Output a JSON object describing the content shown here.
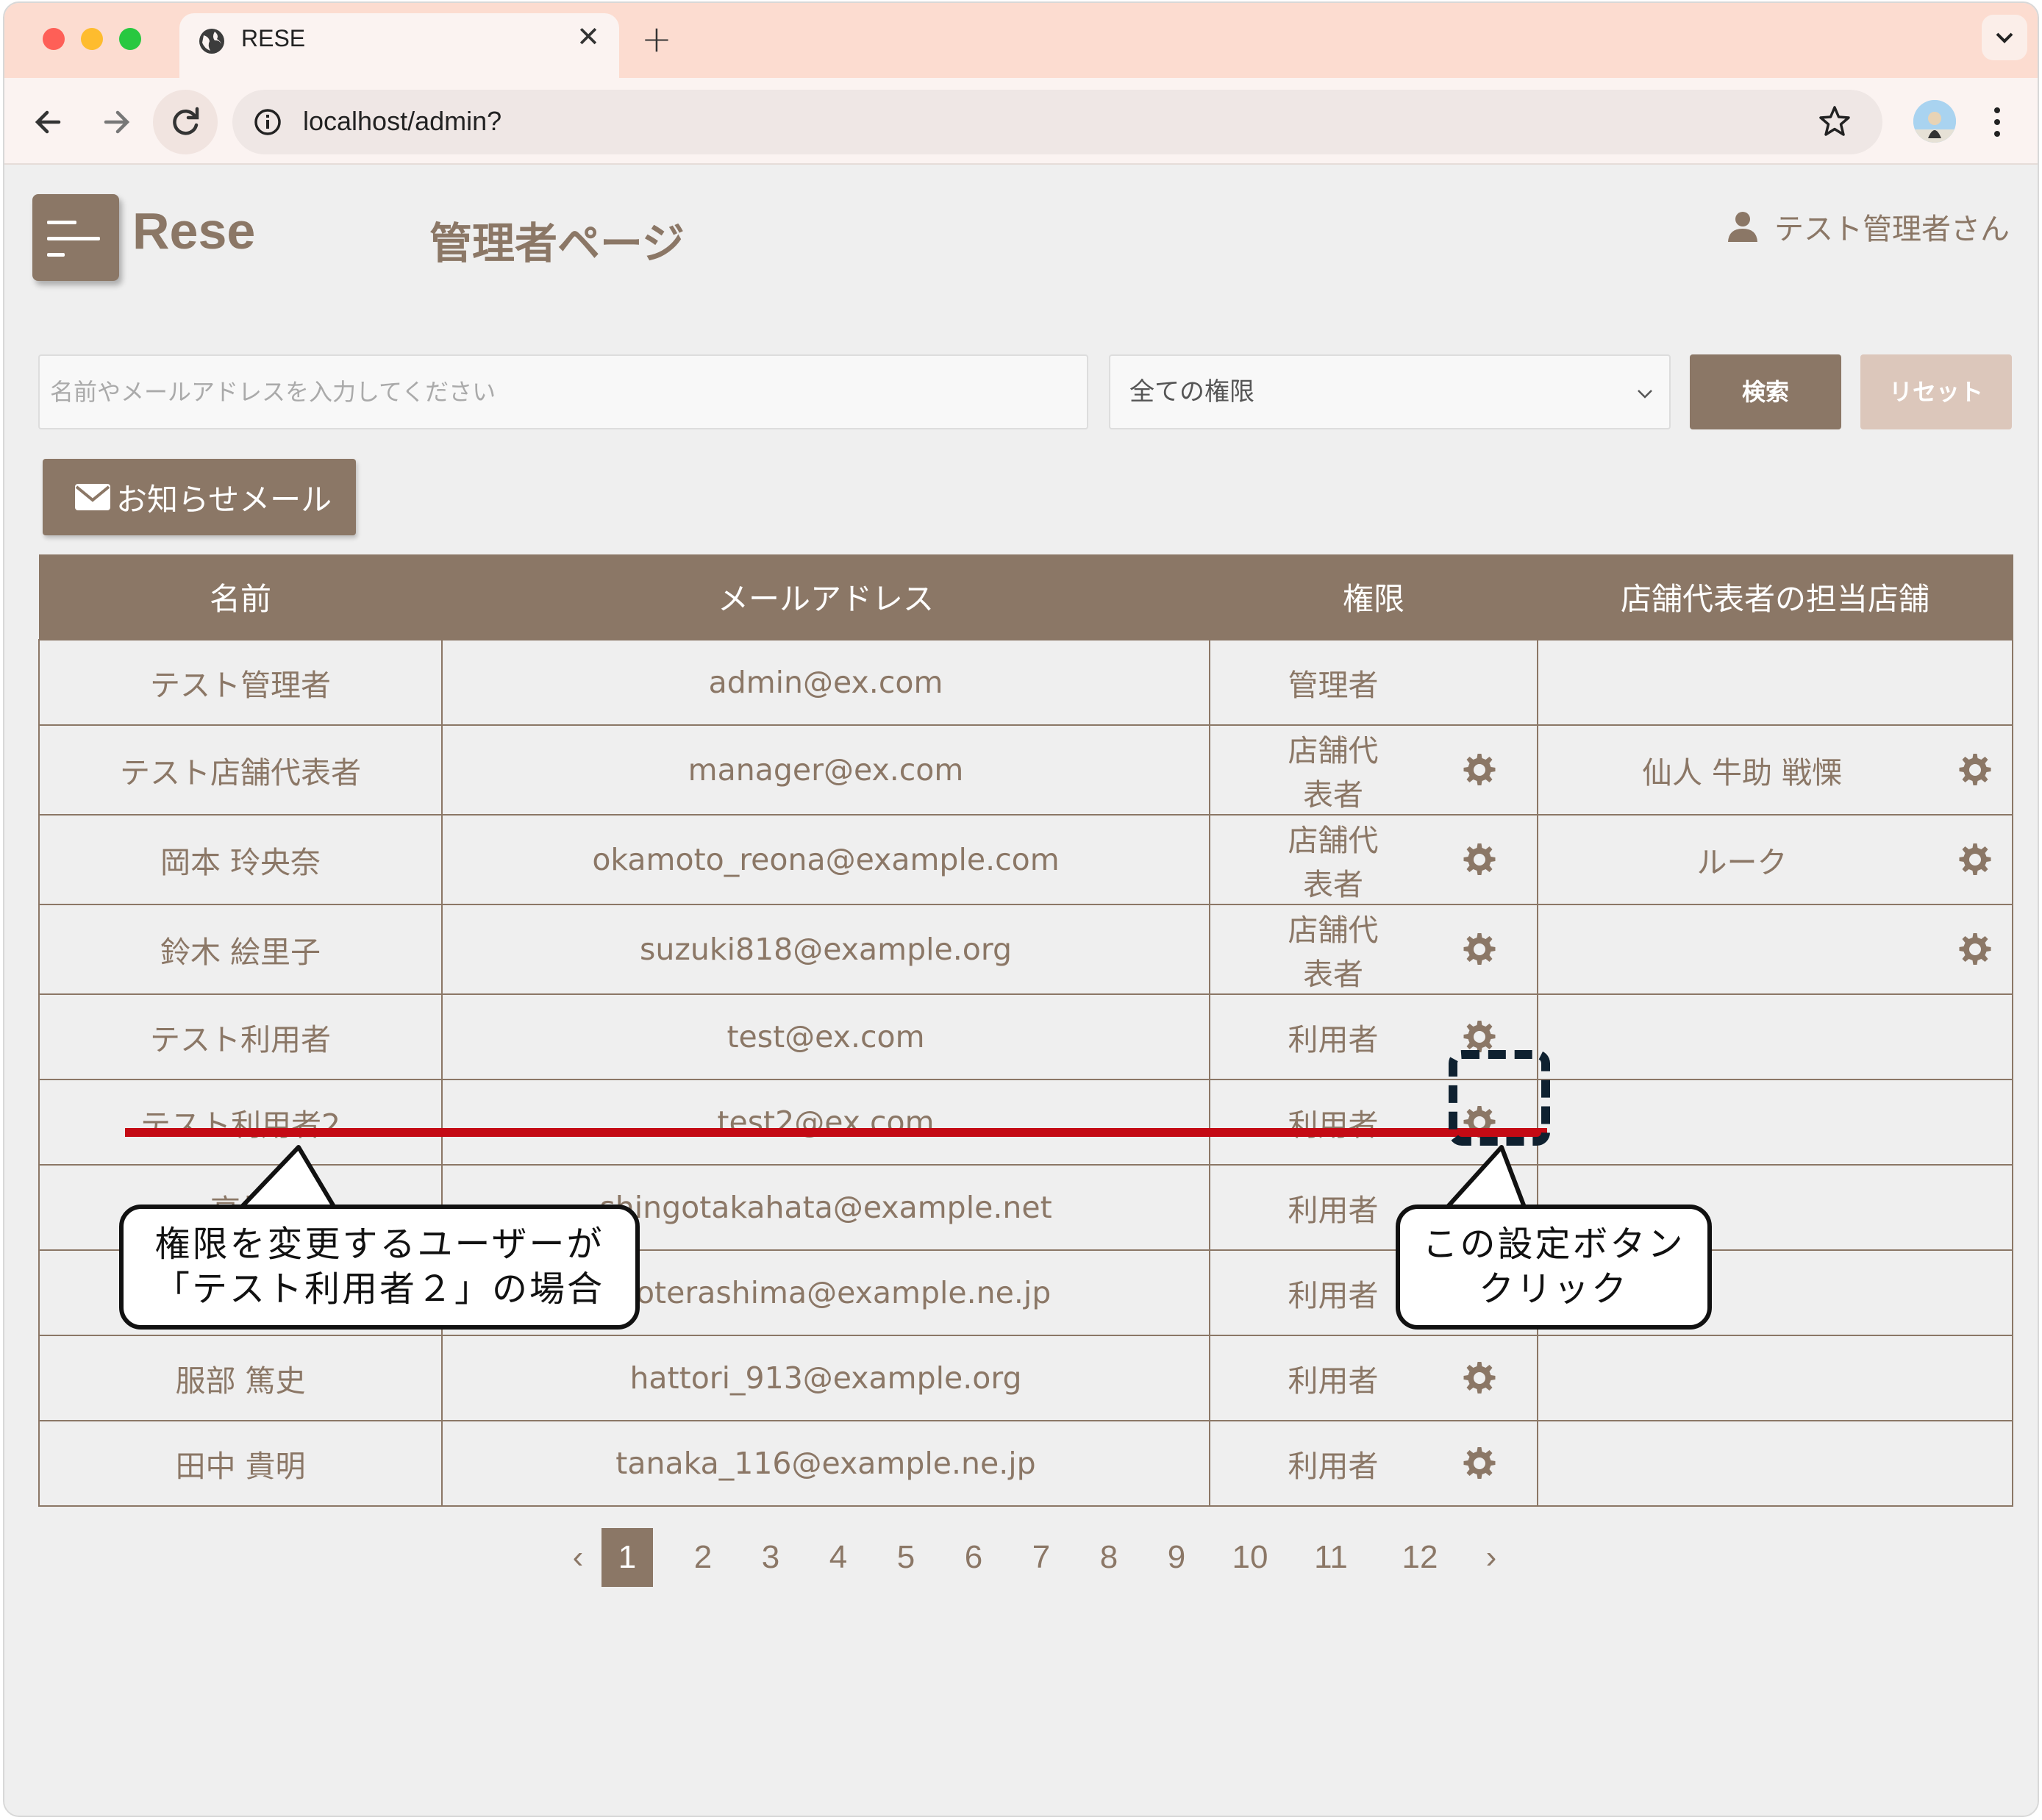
{
  "browser": {
    "tab_title": "RESE",
    "tab_close": "✕",
    "new_tab": "+",
    "url": "localhost/admin?"
  },
  "header": {
    "logo": "Rese",
    "page_title": "管理者ページ",
    "user_name": "テスト管理者さん"
  },
  "search": {
    "placeholder": "名前やメールアドレスを入力してください",
    "role_selected": "全ての権限",
    "search_label": "検索",
    "reset_label": "リセット"
  },
  "mail_button": {
    "label": "お知らせメール"
  },
  "table": {
    "columns": [
      "名前",
      "メールアドレス",
      "権限",
      "店舗代表者の担当店舗"
    ],
    "rows": [
      {
        "name": "テスト管理者",
        "email": "admin@ex.com",
        "role": "管理者",
        "shop": ""
      },
      {
        "name": "テスト店舗代表者",
        "email": "manager@ex.com",
        "role": "店舗代表者",
        "shop": "仙人 牛助 戦慄"
      },
      {
        "name": "岡本 玲央奈",
        "email": "okamoto_reona@example.com",
        "role": "店舗代表者",
        "shop": "ルーク"
      },
      {
        "name": "鈴木 絵里子",
        "email": "suzuki818@example.org",
        "role": "店舗代表者",
        "shop": ""
      },
      {
        "name": "テスト利用者",
        "email": "test@ex.com",
        "role": "利用者",
        "shop": ""
      },
      {
        "name": "テスト利用者2",
        "email": "test2@ex.com",
        "role": "利用者",
        "shop": ""
      },
      {
        "name": "高畑",
        "email": "shingotakahata@example.net",
        "role": "利用者",
        "shop": ""
      },
      {
        "name": "",
        "email": "ukoterashima@example.ne.jp",
        "role": "利用者",
        "shop": ""
      },
      {
        "name": "服部 篤史",
        "email": "hattori_913@example.org",
        "role": "利用者",
        "shop": ""
      },
      {
        "name": "田中 貴明",
        "email": "tanaka_116@example.ne.jp",
        "role": "利用者",
        "shop": ""
      }
    ]
  },
  "pagination": {
    "prev": "‹",
    "next": "›",
    "pages": [
      "1",
      "2",
      "3",
      "4",
      "5",
      "6",
      "7",
      "8",
      "9",
      "10",
      "11",
      "12"
    ],
    "current": "1"
  },
  "annotations": {
    "left_line1": "権限を変更するユーザーが",
    "left_line2": "「テスト利用者２」の場合",
    "right_line1": "この設定ボタン",
    "right_line2": "クリック",
    "underline_color": "#c40a14",
    "focus_color": "#0f2130"
  },
  "colors": {
    "brand": "#8b7766",
    "reset_button": "#dcc7bb",
    "tabbar": "#fcdcd0"
  }
}
